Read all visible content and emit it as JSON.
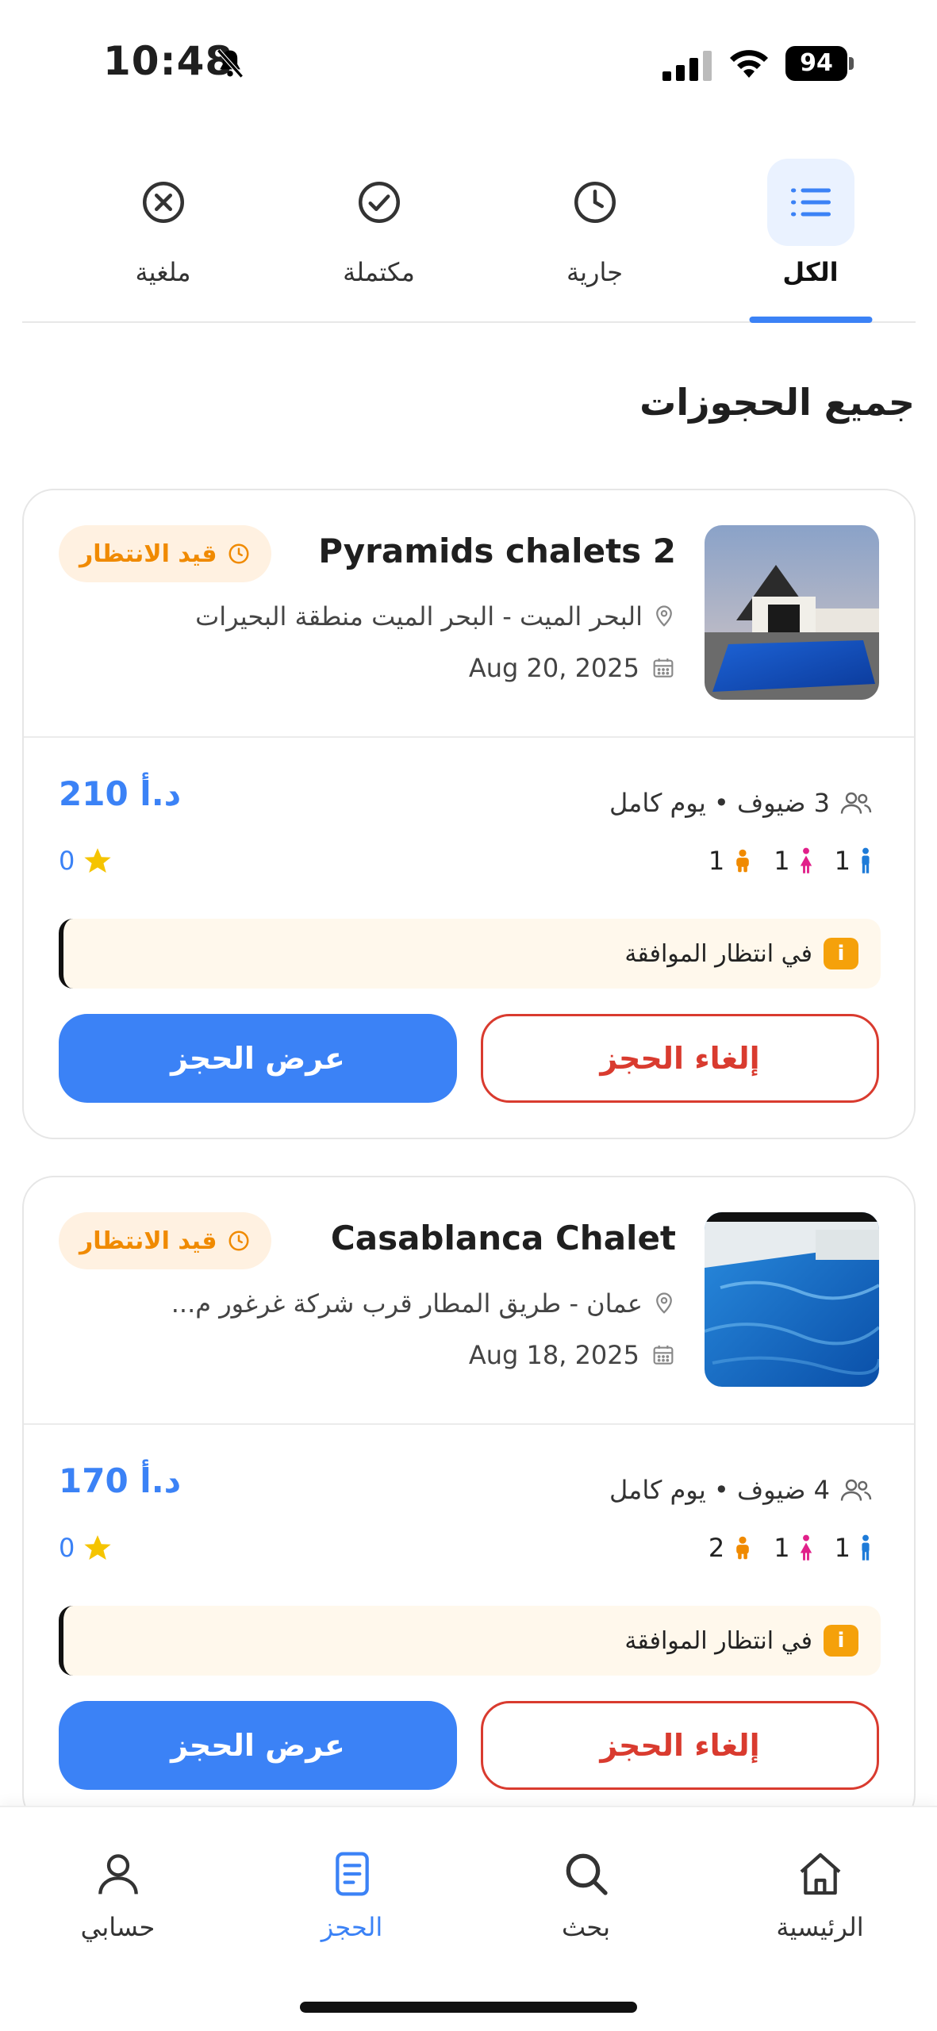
{
  "status_bar": {
    "time": "10:48",
    "battery": "94"
  },
  "tabs": [
    {
      "label": "الكل",
      "icon": "list-icon",
      "active": true
    },
    {
      "label": "جارية",
      "icon": "clock-icon",
      "active": false
    },
    {
      "label": "مكتملة",
      "icon": "check-circle-icon",
      "active": false
    },
    {
      "label": "ملغية",
      "icon": "x-circle-icon",
      "active": false
    }
  ],
  "section_title": "جميع الحجوزات",
  "bookings": [
    {
      "name": "Pyramids chalets 2",
      "location": "البحر الميت - البحر الميت منطقة البحيرات",
      "date": "Aug 20, 2025",
      "status": "قيد الانتظار",
      "guests_text": "3 ضيوف • يوم كامل",
      "price": "210 د.أ",
      "counts": {
        "men": "1",
        "women": "1",
        "children": "1"
      },
      "rating": "0",
      "notice": "في انتظار الموافقة",
      "cancel_label": "إلغاء الحجز",
      "view_label": "عرض الحجز"
    },
    {
      "name": "Casablanca Chalet",
      "location": "عمان - طريق المطار قرب شركة غرغور م...",
      "date": "Aug 18, 2025",
      "status": "قيد الانتظار",
      "guests_text": "4 ضيوف • يوم كامل",
      "price": "170 د.أ",
      "counts": {
        "men": "1",
        "women": "1",
        "children": "2"
      },
      "rating": "0",
      "notice": "في انتظار الموافقة",
      "cancel_label": "إلغاء الحجز",
      "view_label": "عرض الحجز"
    }
  ],
  "bottom_nav": [
    {
      "label": "الرئيسية",
      "icon": "home-icon"
    },
    {
      "label": "بحث",
      "icon": "search-icon"
    },
    {
      "label": "الحجز",
      "icon": "booking-icon",
      "active": true
    },
    {
      "label": "حسابي",
      "icon": "user-icon"
    }
  ],
  "colors": {
    "accent": "#3b82f6",
    "pending": "#f08a00",
    "danger": "#d93b2f",
    "men": "#1e7bd8",
    "women": "#e1208a",
    "children": "#f08a00"
  }
}
